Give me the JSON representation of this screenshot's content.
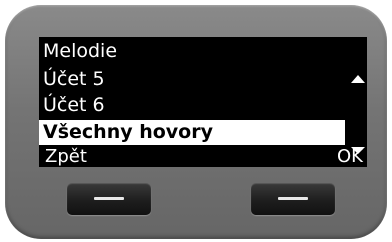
{
  "screen": {
    "title": "Melodie",
    "list": [
      {
        "label": "Účet 5",
        "selected": false
      },
      {
        "label": "Účet 6",
        "selected": false
      },
      {
        "label": "Všechny hovory",
        "selected": true
      }
    ],
    "scroll_up_icon": "triangle-up",
    "scroll_down_icon": "triangle-down",
    "softkeys": {
      "left": "Zpět",
      "right": "OK"
    }
  },
  "hardware": {
    "left_key_icon": "dash",
    "right_key_icon": "dash"
  },
  "colors": {
    "screen_bg": "#000000",
    "text": "#ffffff",
    "highlight_bg": "#ffffff",
    "highlight_text": "#000000",
    "device_body": "#747474"
  }
}
